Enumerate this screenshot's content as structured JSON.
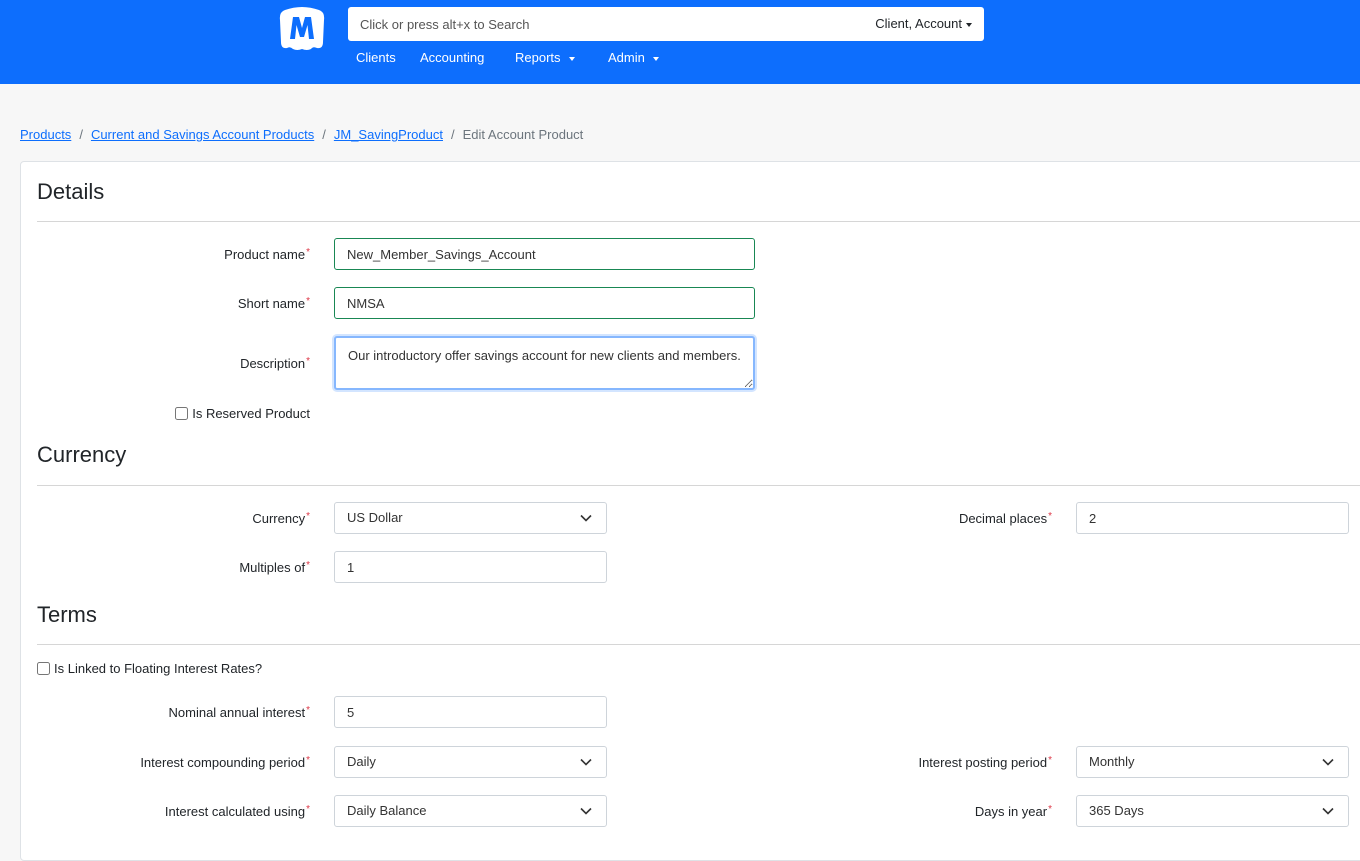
{
  "search": {
    "placeholder": "Click or press alt+x to Search",
    "scope_label": "Client, Account"
  },
  "nav": {
    "clients": "Clients",
    "accounting": "Accounting",
    "reports": "Reports",
    "admin": "Admin"
  },
  "breadcrumb": {
    "products": "Products",
    "current_savings": "Current and Savings Account Products",
    "product": "JM_SavingProduct",
    "current": "Edit Account Product",
    "separator": "/"
  },
  "details": {
    "title": "Details",
    "product_name_label": "Product name",
    "product_name_value": "New_Member_Savings_Account",
    "short_name_label": "Short name",
    "short_name_value": "NMSA",
    "description_label": "Description",
    "description_value": "Our introductory offer savings account for new clients and members.",
    "reserved_label": "Is Reserved Product"
  },
  "currency": {
    "title": "Currency",
    "currency_label": "Currency",
    "currency_value": "US Dollar",
    "decimal_label": "Decimal places",
    "decimal_value": "2",
    "multiples_label": "Multiples of",
    "multiples_value": "1"
  },
  "terms": {
    "title": "Terms",
    "floating_label": "Is Linked to Floating Interest Rates?",
    "nominal_label": "Nominal annual interest",
    "nominal_value": "5",
    "compounding_label": "Interest compounding period",
    "compounding_value": "Daily",
    "posting_label": "Interest posting period",
    "posting_value": "Monthly",
    "calculated_label": "Interest calculated using",
    "calculated_value": "Daily Balance",
    "days_label": "Days in year",
    "days_value": "365 Days"
  },
  "required_mark": "*",
  "colors": {
    "navbar": "#0d6efd",
    "link": "#0d6efd",
    "required": "#dc3545",
    "valid_border": "#198754"
  }
}
